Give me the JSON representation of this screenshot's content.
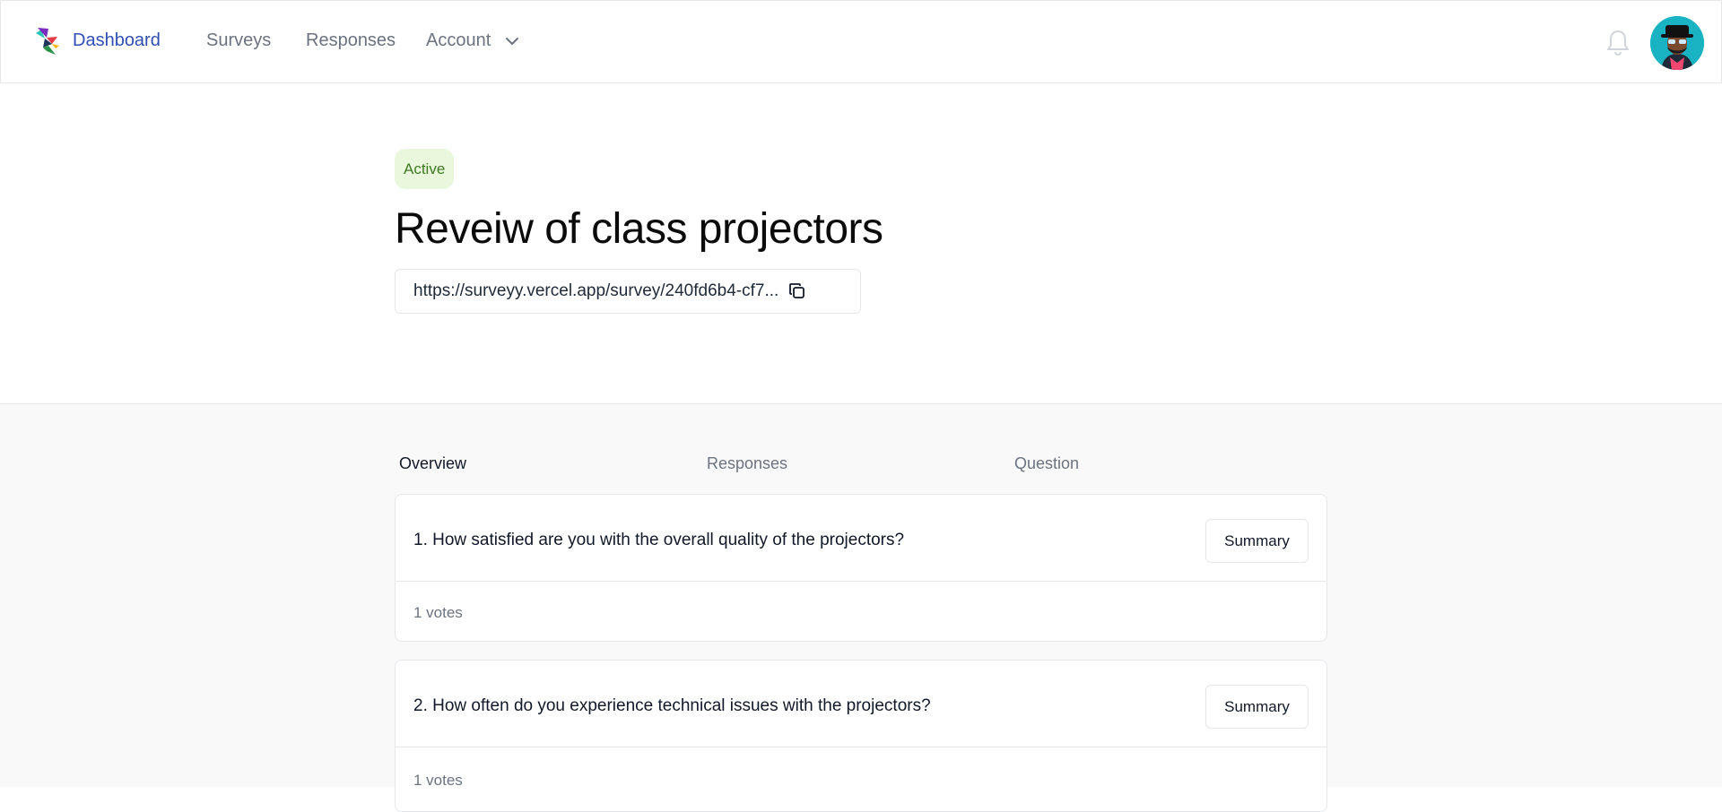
{
  "nav": {
    "dashboard": "Dashboard",
    "surveys": "Surveys",
    "responses": "Responses",
    "account": "Account",
    "icons": [
      "hummingbird-logo-icon",
      "chevron-down-icon",
      "bell-icon"
    ],
    "active_color": "#2f4fb5"
  },
  "survey": {
    "status": "Active",
    "title": "Reveiw of class projectors",
    "url": "https://surveyy.vercel.app/survey/240fd6b4-cf7..."
  },
  "tabs": {
    "overview": "Overview",
    "responses": "Responses",
    "question": "Question"
  },
  "questions": [
    {
      "text": "1. How satisfied are you with the overall quality of the projectors?",
      "button": "Summary",
      "votes": "1 votes"
    },
    {
      "text": "2. How often do you experience technical issues with the projectors?",
      "button": "Summary",
      "votes": "1 votes"
    }
  ]
}
